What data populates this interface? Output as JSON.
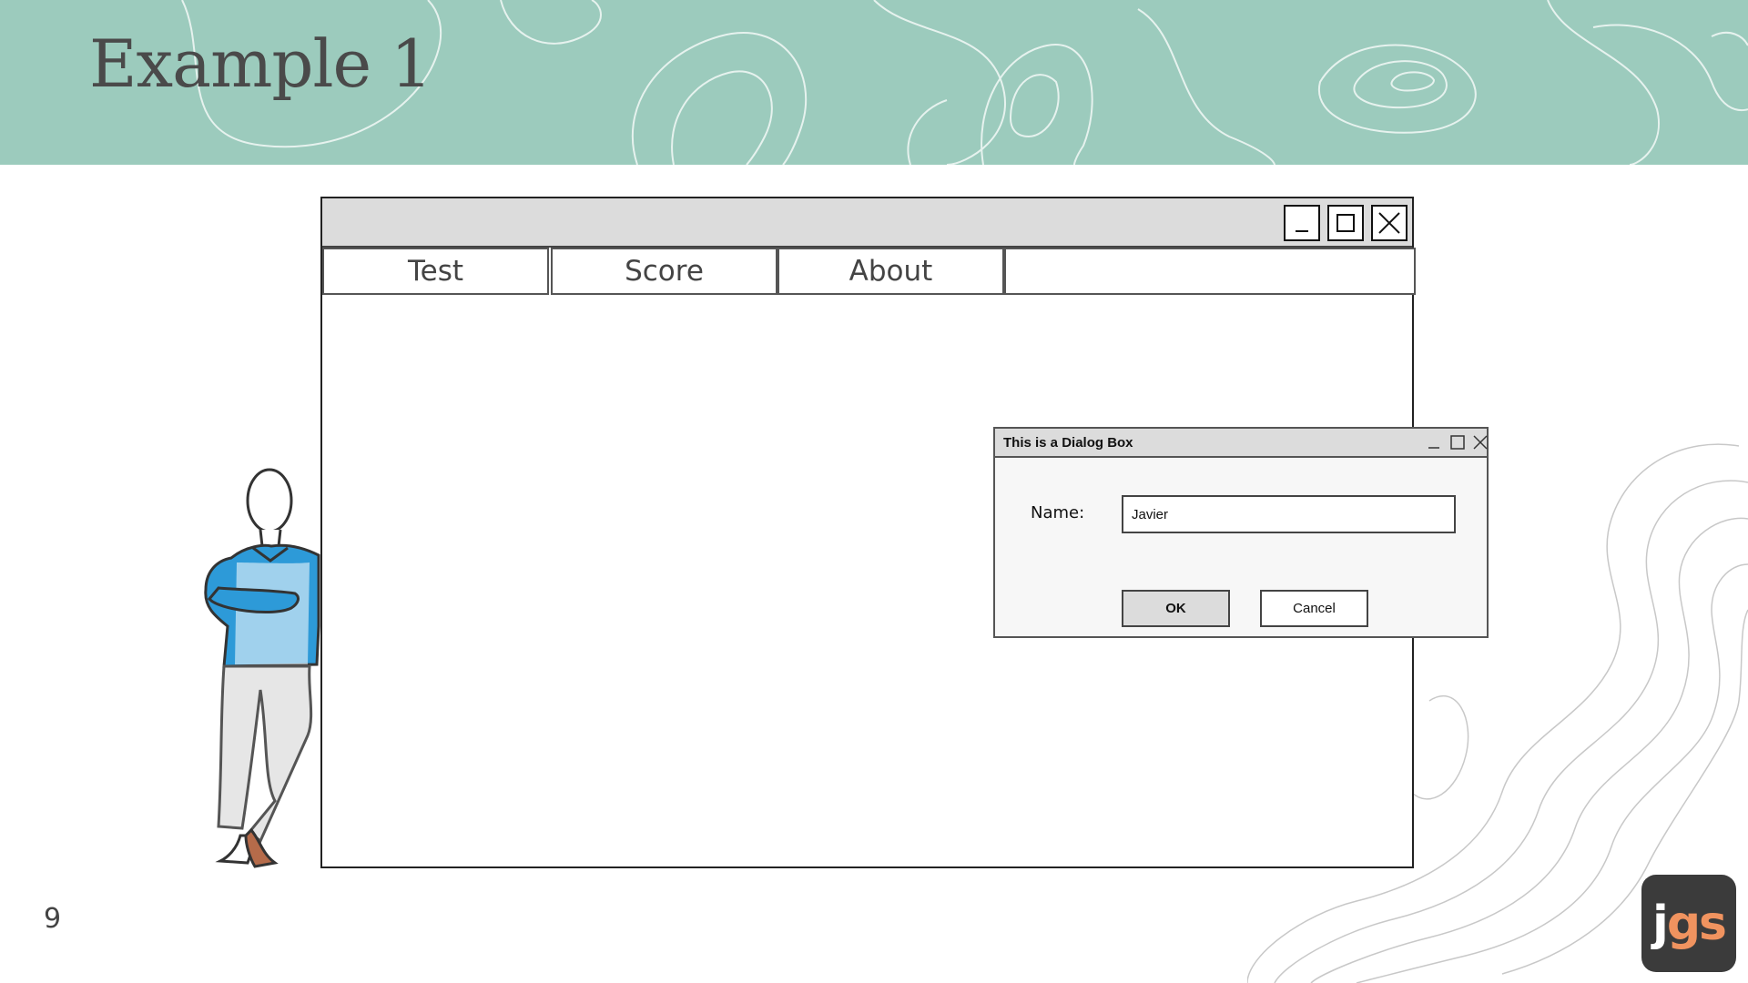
{
  "slide": {
    "title": "Example 1",
    "page_number": "9",
    "logo_text_white": "j",
    "logo_text_orange": "gs"
  },
  "window": {
    "controls": [
      "minimize-icon",
      "maximize-icon",
      "close-icon"
    ],
    "tabs": [
      {
        "label": "Test"
      },
      {
        "label": "Score"
      },
      {
        "label": "About"
      },
      {
        "label": ""
      }
    ]
  },
  "dialog": {
    "title": "This is a Dialog Box",
    "name_label": "Name:",
    "name_value": "Javier",
    "ok_label": "OK",
    "cancel_label": "Cancel"
  },
  "colors": {
    "banner": "#9ccbbd",
    "logo_bg": "#3b3b3b",
    "logo_accent": "#f0935f",
    "shirt": "#2d9ad8"
  }
}
